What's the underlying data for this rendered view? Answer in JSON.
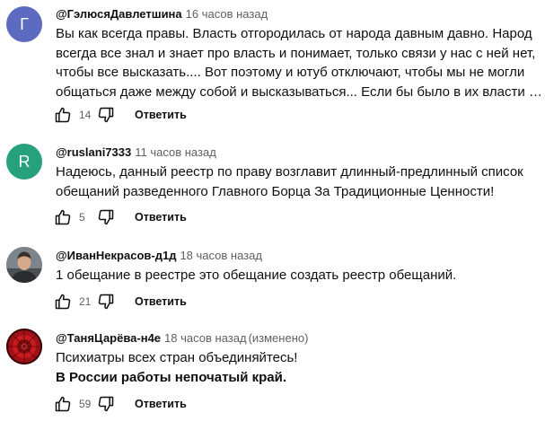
{
  "comments": [
    {
      "author": "@ГэлюсяДавлетшина",
      "time": "16 часов назад",
      "avatar_letter": "Г",
      "avatar_color": "#5c6bc0",
      "lines": [
        "Вы как всегда правы. Власть отгородилась от народа давным давно. Народ",
        "всегда все знал и знает про власть и понимает, только связи у нас с ней нет,",
        "чтобы все высказать.... Вот поэтому и ютуб отключают, чтобы мы не могли",
        "общаться даже между собой и высказываться... Если бы было в их власти жить ..."
      ],
      "likes": "14",
      "reply_label": "Ответить"
    },
    {
      "author": "@ruslani7333",
      "time": "11 часов назад",
      "avatar_letter": "R",
      "avatar_color": "#26a17b",
      "lines": [
        "Надеюсь, данный реестр по праву возглавит длинный-предлинный список",
        "обещаний разведенного Главного Борца За Традиционные Ценности!"
      ],
      "likes": "5",
      "reply_label": "Ответить"
    },
    {
      "author": "@ИванНекрасов-д1д",
      "time": "18 часов назад",
      "lines": [
        "1 обещание в реестре это обещание создать реестр обещаний."
      ],
      "likes": "21",
      "reply_label": "Ответить"
    },
    {
      "author": "@ТаняЦарёва-н4е",
      "time": "18 часов назад",
      "edited": "(изменено)",
      "lines": [
        "Психиатры всех стран объединяйтесь!",
        "В России работы непочатый край."
      ],
      "likes": "59",
      "reply_label": "Ответить"
    }
  ]
}
